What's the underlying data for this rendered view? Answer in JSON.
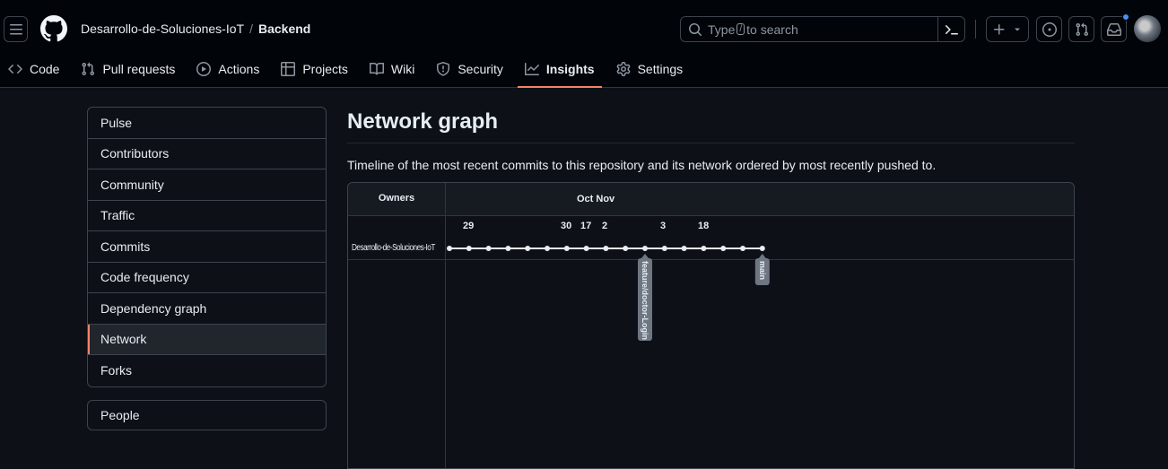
{
  "header": {
    "org": "Desarrollo-de-Soluciones-IoT",
    "separator": "/",
    "repo": "Backend",
    "search_placeholder_prefix": "Type",
    "search_placeholder_key": "/",
    "search_placeholder_suffix": "to search"
  },
  "tabs": [
    {
      "label": "Code",
      "icon": "code-icon"
    },
    {
      "label": "Pull requests",
      "icon": "pull-request-icon"
    },
    {
      "label": "Actions",
      "icon": "play-icon"
    },
    {
      "label": "Projects",
      "icon": "table-icon"
    },
    {
      "label": "Wiki",
      "icon": "book-icon"
    },
    {
      "label": "Security",
      "icon": "shield-icon"
    },
    {
      "label": "Insights",
      "icon": "graph-icon",
      "active": true
    },
    {
      "label": "Settings",
      "icon": "gear-icon"
    }
  ],
  "sidebar": {
    "items": [
      "Pulse",
      "Contributors",
      "Community",
      "Traffic",
      "Commits",
      "Code frequency",
      "Dependency graph",
      "Network",
      "Forks"
    ],
    "active": "Network",
    "secondary": "People"
  },
  "main": {
    "title": "Network graph",
    "description": "Timeline of the most recent commits to this repository and its network ordered by most recently pushed to."
  },
  "graph": {
    "owners_header": "Owners",
    "month_header": "Oct Nov",
    "owner": "Desarrollo-de-Soluciones-IoT",
    "days": [
      "29",
      "30",
      "17",
      "2",
      "3",
      "18"
    ],
    "commit_count": 17,
    "branches": [
      "feature/doctor-Login",
      "main"
    ]
  },
  "colors": {
    "accent": "#f78166",
    "notification": "#4493f8",
    "border": "#3d444d",
    "label_bg": "#6e7681"
  }
}
